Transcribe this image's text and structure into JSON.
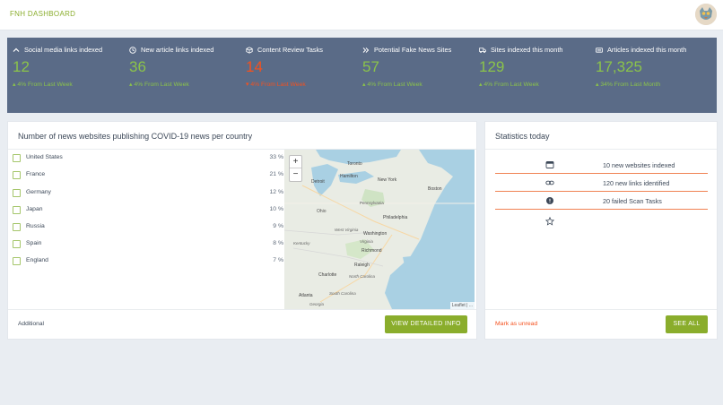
{
  "header": {
    "brand": "FNH DASHBOARD"
  },
  "stats": [
    {
      "label": "Social media links indexed",
      "icon": "chevron-up-icon",
      "value": "12",
      "change": "4% From Last Week",
      "trend": "up"
    },
    {
      "label": "New article links indexed",
      "icon": "clock-icon",
      "value": "36",
      "change": "4% From Last Week",
      "trend": "up"
    },
    {
      "label": "Content Review Tasks",
      "icon": "cube-icon",
      "value": "14",
      "change": "4% From Last Week",
      "trend": "down"
    },
    {
      "label": "Potential Fake News Sites",
      "icon": "double-chevron-right-icon",
      "value": "57",
      "change": "4% From Last Week",
      "trend": "up"
    },
    {
      "label": "Sites indexed this month",
      "icon": "truck-icon",
      "value": "129",
      "change": "4% From Last Week",
      "trend": "up"
    },
    {
      "label": "Articles indexed this month",
      "icon": "keyboard-icon",
      "value": "17,325",
      "change": "34% From Last Month",
      "trend": "up"
    }
  ],
  "colors": {
    "accent": "#8aad2c",
    "band": "#5a6b87",
    "positive": "#8bc34a",
    "negative": "#f4511e"
  },
  "countries_card": {
    "title": "Number of news websites publishing COVID-19 news per country",
    "rows": [
      {
        "name": "United States",
        "pct": "33 %"
      },
      {
        "name": "France",
        "pct": "21 %"
      },
      {
        "name": "Germany",
        "pct": "12 %"
      },
      {
        "name": "Japan",
        "pct": "10 %"
      },
      {
        "name": "Russia",
        "pct": "9 %"
      },
      {
        "name": "Spain",
        "pct": "8 %"
      },
      {
        "name": "England",
        "pct": "7 %"
      }
    ],
    "footer_label": "Additional",
    "button": "VIEW DETAILED INFO"
  },
  "map": {
    "zoom_in": "+",
    "zoom_out": "−",
    "attribution": "Leaflet | ...",
    "labels": [
      "Toronto",
      "Hamilton",
      "Detroit",
      "New York",
      "Boston",
      "Pennsylvania",
      "Ohio",
      "Philadelphia",
      "Washington",
      "West Virginia",
      "Virginia",
      "Richmond",
      "Kentucky",
      "Raleigh",
      "North Carolina",
      "Charlotte",
      "South Carolina",
      "Atlanta",
      "Georgia"
    ]
  },
  "statistics_card": {
    "title": "Statistics today",
    "items": [
      {
        "icon": "window-icon",
        "text": "10 new websites indexed"
      },
      {
        "icon": "link-icon",
        "text": "120 new links identified"
      },
      {
        "icon": "alert-circle-icon",
        "text": "20 failed Scan Tasks"
      },
      {
        "icon": "star-icon",
        "text": ""
      }
    ],
    "footer_link": "Mark as unread",
    "button": "SEE ALL"
  }
}
